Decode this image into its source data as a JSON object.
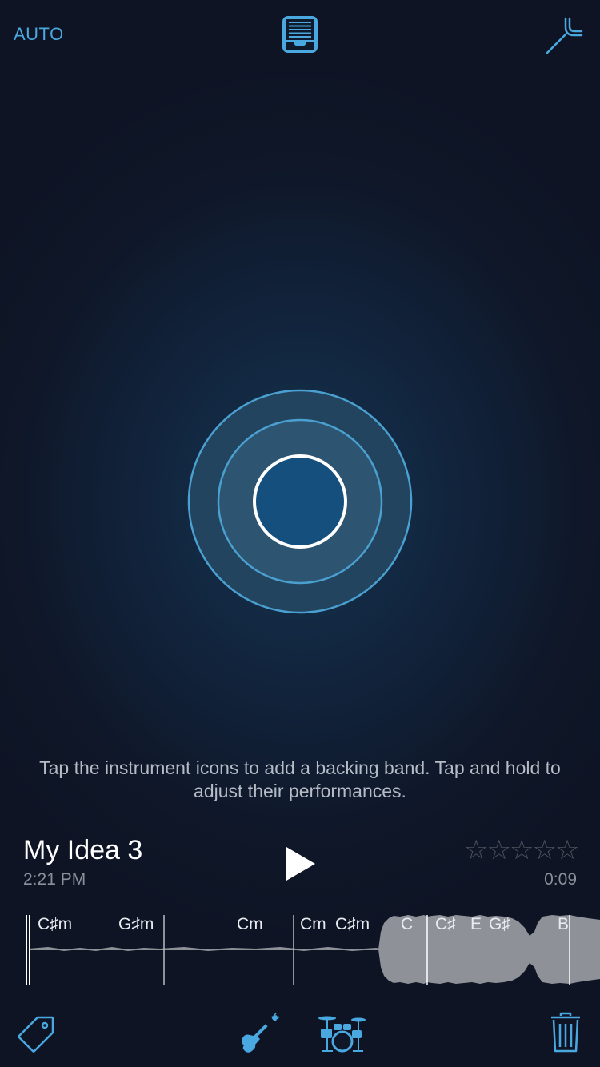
{
  "header": {
    "auto_label": "AUTO",
    "library_icon": "song-library-icon",
    "tuner_icon": "tuning-fork-icon"
  },
  "record": {
    "icon": "record-button-icon"
  },
  "hint": "Tap the instrument icons to add a backing band. Tap and hold to adjust their performances.",
  "recording": {
    "title": "My Idea 3",
    "time": "2:21 PM",
    "duration": "0:09",
    "rating_display": "☆☆☆☆☆",
    "rating_value": 0,
    "rating_max": 5
  },
  "timeline": {
    "chords": [
      "C♯m",
      "G♯m",
      "Cm",
      "Cm",
      "C♯m",
      "C",
      "C♯",
      "E",
      "G♯",
      "B"
    ]
  },
  "toolbar": {
    "tag_icon": "tag-icon",
    "guitar_icon": "bass-guitar-icon",
    "drums_icon": "drum-kit-icon",
    "trash_icon": "trash-icon"
  },
  "colors": {
    "accent": "#4aa8e0",
    "record_fill": "#154f7e",
    "background": "#0f1728"
  }
}
